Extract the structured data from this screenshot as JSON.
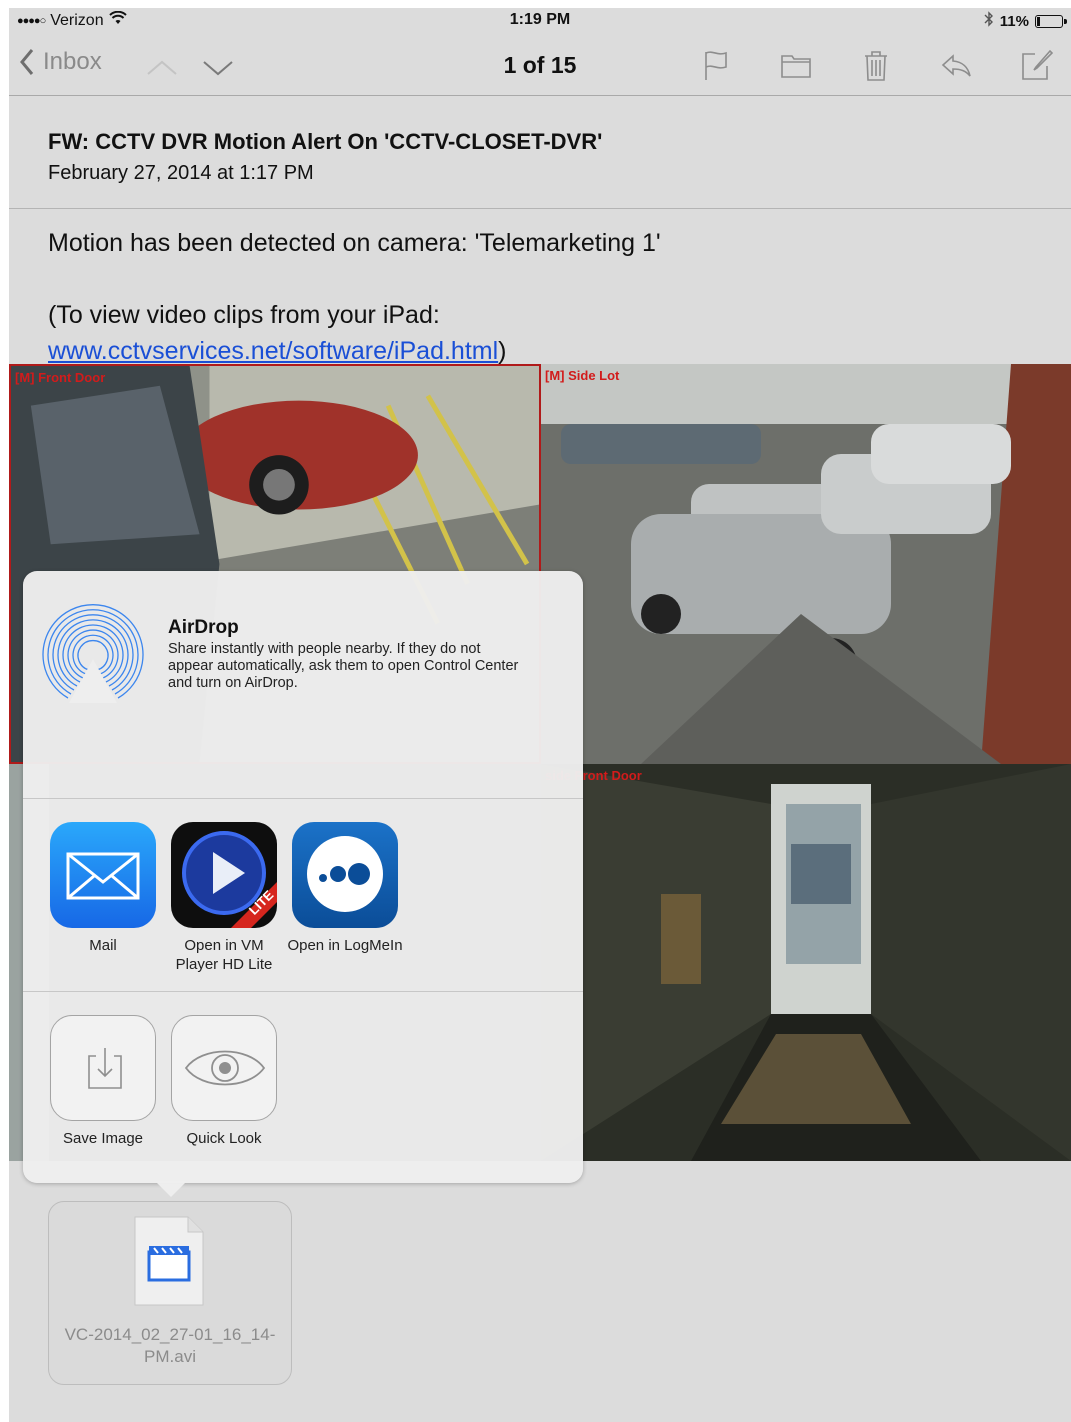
{
  "status_bar": {
    "signal": "●●●●○",
    "carrier": "Verizon",
    "time": "1:19 PM",
    "battery_text": "11%",
    "battery_level": 0.11
  },
  "nav": {
    "back_label": "Inbox",
    "counter": "1 of 15"
  },
  "message": {
    "subject": "FW: CCTV DVR Motion Alert On 'CCTV-CLOSET-DVR'",
    "date": "February 27, 2014 at 1:17 PM",
    "line1": "Motion has been detected on camera: 'Telemarketing 1'",
    "line2": "(To view video clips from your iPad:",
    "link": "www.cctvservices.net/software/iPad.html",
    "link_close": ")"
  },
  "cameras": {
    "front_door": "[M] Front Door",
    "side_lot": "[M] Side Lot",
    "inside_front_door": "side Front Door"
  },
  "share_sheet": {
    "airdrop_title": "AirDrop",
    "airdrop_desc": "Share instantly with people nearby. If they do not appear automatically, ask them to open Control Center and turn on AirDrop.",
    "apps": [
      {
        "label": "Mail",
        "icon": "mail-icon"
      },
      {
        "label": "Open in VM Player HD Lite",
        "icon": "vm-player-icon",
        "badge": "LITE"
      },
      {
        "label": "Open in LogMeIn",
        "icon": "logmein-icon"
      }
    ],
    "actions": [
      {
        "label": "Save Image",
        "icon": "save-image-icon"
      },
      {
        "label": "Quick Look",
        "icon": "eye-icon"
      }
    ]
  },
  "attachment": {
    "filename": "VC-2014_02_27-01_16_14-PM.avi",
    "icon": "video-file-icon"
  },
  "colors": {
    "link": "#1a4fd6",
    "camera_label": "#d21b1b",
    "mail_blue": "#1e8cf3",
    "background": "#dcdcdc"
  }
}
